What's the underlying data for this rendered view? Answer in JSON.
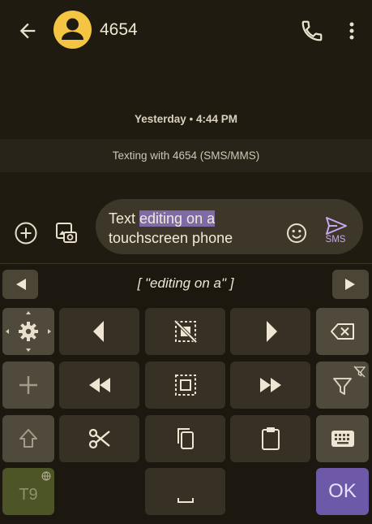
{
  "header": {
    "back_icon": "arrow-left-icon",
    "contact_name": "4654",
    "avatar_icon": "person-icon",
    "avatar_color": "#f4c542",
    "call_icon": "phone-icon",
    "more_icon": "more-vert-icon"
  },
  "conversation": {
    "timestamp_day": "Yesterday",
    "timestamp_sep": " • ",
    "timestamp_time": "4:44 PM",
    "texting_banner": "Texting with 4654 (SMS/MMS)"
  },
  "composer": {
    "text_before": "Text ",
    "text_selected": "editing on a",
    "text_after": "\ntouchscreen phone",
    "send_label": "SMS",
    "accent_color": "#c9a7f4",
    "selection_color": "#7d6ba6"
  },
  "keyboard": {
    "suggestion": "[ \"editing on a\" ]",
    "t9_label": "T9",
    "ok_label": "OK",
    "ok_color": "#6e58a8"
  }
}
